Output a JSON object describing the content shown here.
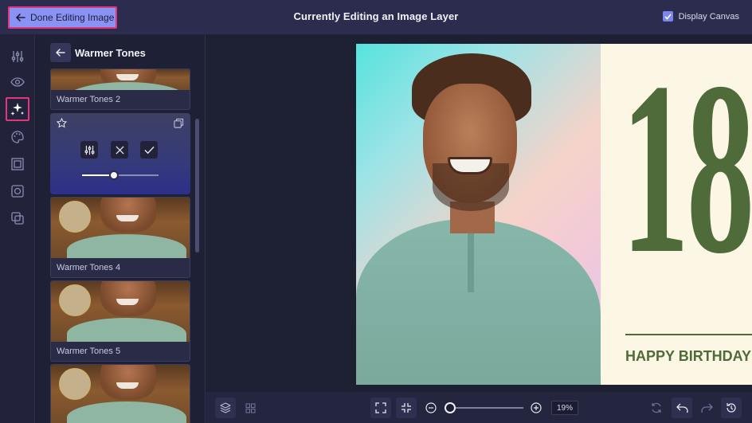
{
  "header": {
    "done_label": "Done Editing Image",
    "title": "Currently Editing an Image Layer",
    "display_canvas_label": "Display Canvas",
    "display_canvas_checked": true
  },
  "rail": {
    "icons": [
      "adjustments-icon",
      "eye-icon",
      "sparkle-effects-icon",
      "palette-icon",
      "frame-icon",
      "crop-icon",
      "layers-stack-icon"
    ],
    "active": "sparkle-effects-icon"
  },
  "panel": {
    "title": "Warmer Tones",
    "filters": [
      {
        "label": "Warmer Tones 2"
      },
      {
        "label": "Warmer Tones 4"
      },
      {
        "label": "Warmer Tones 5"
      }
    ],
    "selected_intensity": 0.42
  },
  "canvas": {
    "big_number": "18",
    "card_text": "HAPPY BIRTHDAY"
  },
  "bottom": {
    "zoom_value": "19%",
    "zoom_level": 0.19
  },
  "colors": {
    "accent": "#8893f3",
    "highlight_border": "#e2357b",
    "card_green": "#4f6b3a",
    "card_cream": "#fbf7e4",
    "topbar_bg": "#2c2d4e",
    "canvas_bg": "#1c2032"
  }
}
